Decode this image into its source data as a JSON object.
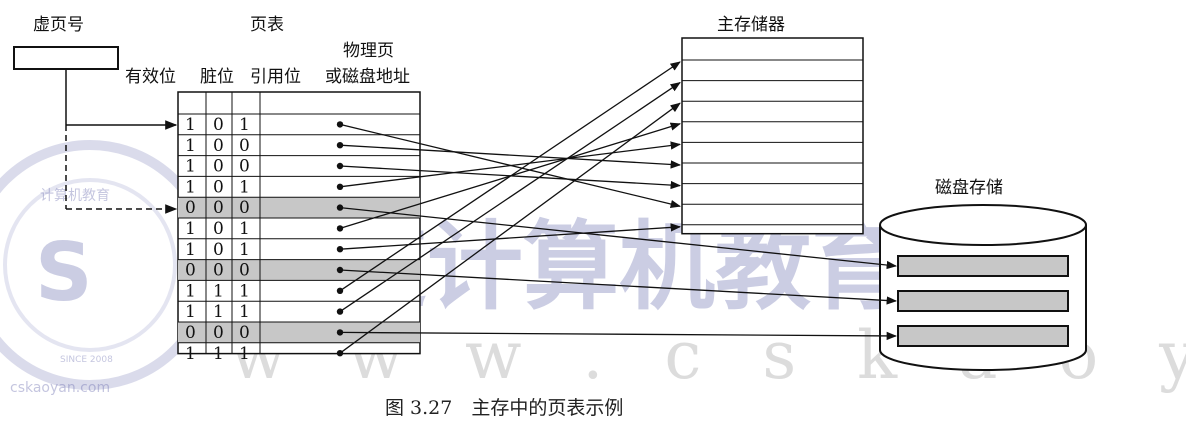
{
  "labels": {
    "virtual_page_no": "虚页号",
    "page_table": "页表",
    "main_memory": "主存储器",
    "disk_storage": "磁盘存储",
    "col_valid": "有效位",
    "col_dirty": "脏位",
    "col_ref": "引用位",
    "col_phys_line1": "物理页",
    "col_phys_line2": "或磁盘地址"
  },
  "caption": "图 3.27　主存中的页表示例",
  "rows": [
    {
      "bits": [
        "1",
        "0",
        "1"
      ],
      "shaded": false
    },
    {
      "bits": [
        "1",
        "0",
        "0"
      ],
      "shaded": false
    },
    {
      "bits": [
        "1",
        "0",
        "0"
      ],
      "shaded": false
    },
    {
      "bits": [
        "1",
        "0",
        "1"
      ],
      "shaded": false
    },
    {
      "bits": [
        "0",
        "0",
        "0"
      ],
      "shaded": true
    },
    {
      "bits": [
        "1",
        "0",
        "1"
      ],
      "shaded": false
    },
    {
      "bits": [
        "1",
        "0",
        "1"
      ],
      "shaded": false
    },
    {
      "bits": [
        "0",
        "0",
        "0"
      ],
      "shaded": true
    },
    {
      "bits": [
        "1",
        "1",
        "1"
      ],
      "shaded": false
    },
    {
      "bits": [
        "1",
        "1",
        "1"
      ],
      "shaded": false
    },
    {
      "bits": [
        "0",
        "0",
        "0"
      ],
      "shaded": true
    },
    {
      "bits": [
        "1",
        "1",
        "1"
      ],
      "shaded": false
    }
  ],
  "main_memory_slot_count": 9,
  "disk_block_count": 3,
  "watermark": {
    "big_text": "王道计算机教育",
    "url_text": "w w w . c s k a o y a n . c o m",
    "logo_text_top": "计算机教育",
    "logo_text_since": "SINCE 2008",
    "logo_text_url": "cskaoyan.com"
  },
  "colors": {
    "shade": "#c7c7c7",
    "line": "#111111"
  }
}
